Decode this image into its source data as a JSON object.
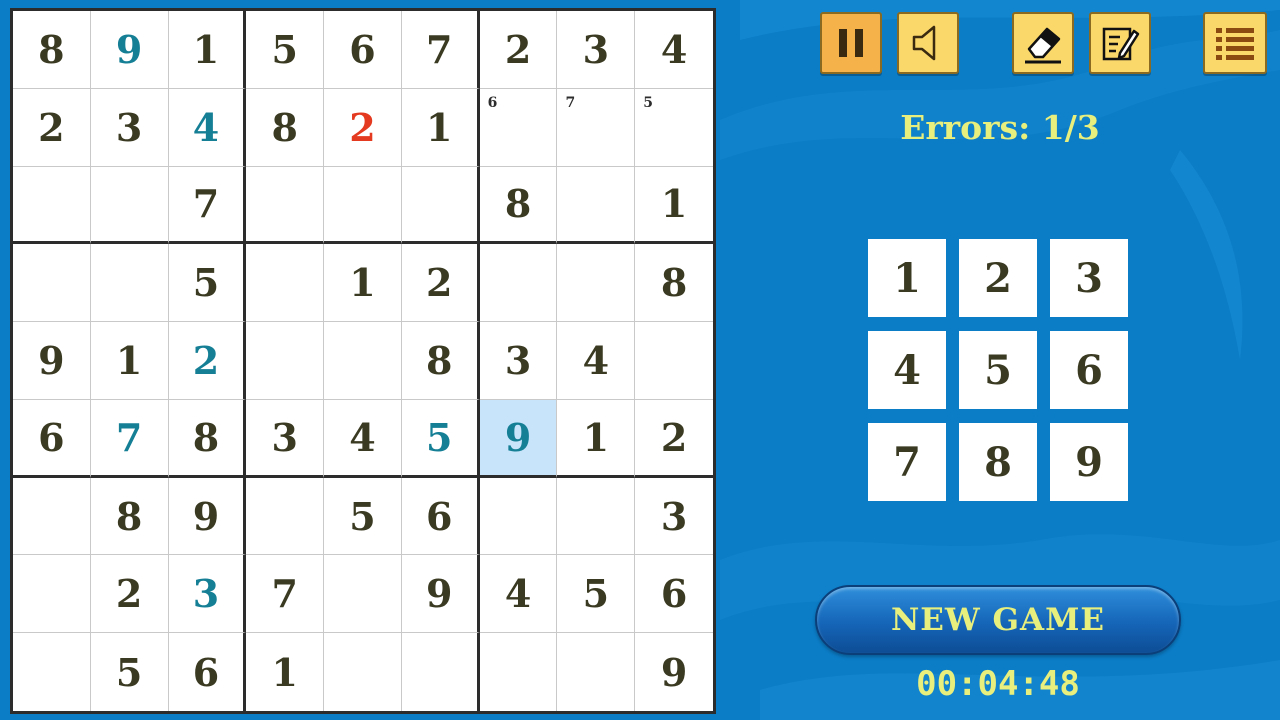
{
  "board": {
    "rows": [
      [
        {
          "v": "8",
          "t": "given"
        },
        {
          "v": "9",
          "t": "user"
        },
        {
          "v": "1",
          "t": "given"
        },
        {
          "v": "5",
          "t": "given"
        },
        {
          "v": "6",
          "t": "given"
        },
        {
          "v": "7",
          "t": "given"
        },
        {
          "v": "2",
          "t": "given"
        },
        {
          "v": "3",
          "t": "given"
        },
        {
          "v": "4",
          "t": "given"
        }
      ],
      [
        {
          "v": "2",
          "t": "given"
        },
        {
          "v": "3",
          "t": "given"
        },
        {
          "v": "4",
          "t": "user"
        },
        {
          "v": "8",
          "t": "given"
        },
        {
          "v": "2",
          "t": "error"
        },
        {
          "v": "1",
          "t": "given"
        },
        {
          "v": "",
          "t": "note",
          "note": "6"
        },
        {
          "v": "",
          "t": "note",
          "note": "7"
        },
        {
          "v": "",
          "t": "note",
          "note": "5"
        }
      ],
      [
        {
          "v": "",
          "t": "empty"
        },
        {
          "v": "",
          "t": "empty"
        },
        {
          "v": "7",
          "t": "given"
        },
        {
          "v": "",
          "t": "empty"
        },
        {
          "v": "",
          "t": "empty"
        },
        {
          "v": "",
          "t": "empty"
        },
        {
          "v": "8",
          "t": "given"
        },
        {
          "v": "",
          "t": "empty"
        },
        {
          "v": "1",
          "t": "given"
        }
      ],
      [
        {
          "v": "",
          "t": "empty"
        },
        {
          "v": "",
          "t": "empty"
        },
        {
          "v": "5",
          "t": "given"
        },
        {
          "v": "",
          "t": "empty"
        },
        {
          "v": "1",
          "t": "given"
        },
        {
          "v": "2",
          "t": "given"
        },
        {
          "v": "",
          "t": "empty"
        },
        {
          "v": "",
          "t": "empty"
        },
        {
          "v": "8",
          "t": "given"
        }
      ],
      [
        {
          "v": "9",
          "t": "given"
        },
        {
          "v": "1",
          "t": "given"
        },
        {
          "v": "2",
          "t": "user"
        },
        {
          "v": "",
          "t": "empty"
        },
        {
          "v": "",
          "t": "empty"
        },
        {
          "v": "8",
          "t": "given"
        },
        {
          "v": "3",
          "t": "given"
        },
        {
          "v": "4",
          "t": "given"
        },
        {
          "v": "",
          "t": "empty"
        }
      ],
      [
        {
          "v": "6",
          "t": "given"
        },
        {
          "v": "7",
          "t": "user"
        },
        {
          "v": "8",
          "t": "given"
        },
        {
          "v": "3",
          "t": "given"
        },
        {
          "v": "4",
          "t": "given"
        },
        {
          "v": "5",
          "t": "user"
        },
        {
          "v": "9",
          "t": "user",
          "selected": true
        },
        {
          "v": "1",
          "t": "given"
        },
        {
          "v": "2",
          "t": "given"
        }
      ],
      [
        {
          "v": "",
          "t": "empty"
        },
        {
          "v": "8",
          "t": "given"
        },
        {
          "v": "9",
          "t": "given"
        },
        {
          "v": "",
          "t": "empty"
        },
        {
          "v": "5",
          "t": "given"
        },
        {
          "v": "6",
          "t": "given"
        },
        {
          "v": "",
          "t": "empty"
        },
        {
          "v": "",
          "t": "empty"
        },
        {
          "v": "3",
          "t": "given"
        }
      ],
      [
        {
          "v": "",
          "t": "empty"
        },
        {
          "v": "2",
          "t": "given"
        },
        {
          "v": "3",
          "t": "user"
        },
        {
          "v": "7",
          "t": "given"
        },
        {
          "v": "",
          "t": "empty"
        },
        {
          "v": "9",
          "t": "given"
        },
        {
          "v": "4",
          "t": "given"
        },
        {
          "v": "5",
          "t": "given"
        },
        {
          "v": "6",
          "t": "given"
        }
      ],
      [
        {
          "v": "",
          "t": "empty"
        },
        {
          "v": "5",
          "t": "given"
        },
        {
          "v": "6",
          "t": "given"
        },
        {
          "v": "1",
          "t": "given"
        },
        {
          "v": "",
          "t": "empty"
        },
        {
          "v": "",
          "t": "empty"
        },
        {
          "v": "",
          "t": "empty"
        },
        {
          "v": "",
          "t": "empty"
        },
        {
          "v": "9",
          "t": "given"
        }
      ]
    ]
  },
  "toolbar": {
    "pause_icon": "pause-icon",
    "sound_icon": "speaker-icon",
    "erase_icon": "eraser-icon",
    "notes_icon": "pencil-notes-icon",
    "menu_icon": "menu-list-icon"
  },
  "status": {
    "errors": "Errors: 1/3",
    "timer": "00:04:48"
  },
  "numpad": {
    "keys": [
      "1",
      "2",
      "3",
      "4",
      "5",
      "6",
      "7",
      "8",
      "9"
    ]
  },
  "new_game_label": "NEW GAME",
  "colors": {
    "background": "#0b7cc6",
    "given_digit": "#3a3a22",
    "user_digit": "#157f96",
    "error_digit": "#e43a1f",
    "selected_cell": "#c7e4fa",
    "accent_text": "#e8ef7c",
    "tool_button": "#fbd86a"
  }
}
